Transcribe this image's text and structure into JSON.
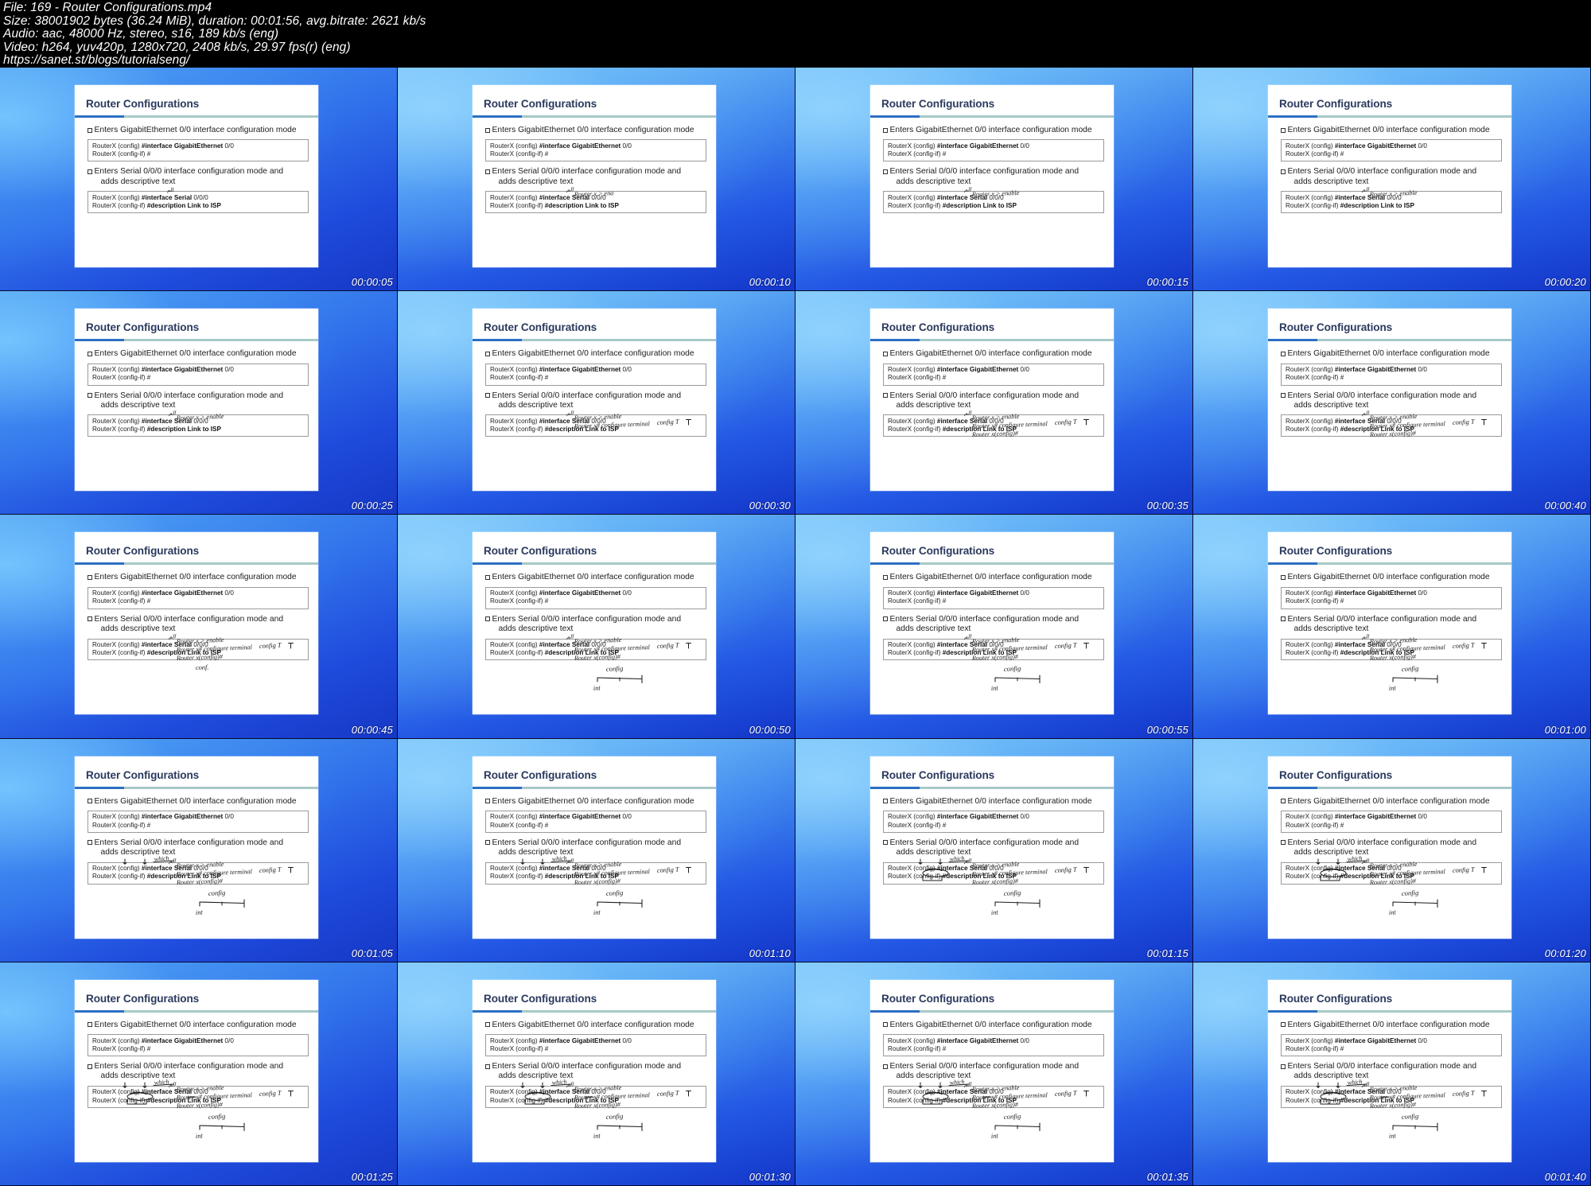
{
  "header": {
    "lines": [
      "File: 169 - Router Configurations.mp4",
      "Size: 38001902 bytes (36.24 MiB), duration: 00:01:56, avg.bitrate: 2621 kb/s",
      "Audio: aac, 48000 Hz, stereo, s16, 189 kb/s (eng)",
      "Video: h264, yuv420p, 1280x720, 2408 kb/s, 29.97 fps(r) (eng)",
      "https://sanet.st/blogs/tutorialseng/"
    ],
    "file_label": "File: 169 - Router Configurations.mp4",
    "size_label": "Size: 38001902 bytes (36.24 MiB), duration: 00:01:56, avg.bitrate: 2621 kb/s",
    "audio_label": "Audio: aac, 48000 Hz, stereo, s16, 189 kb/s (eng)",
    "video_label": "Video: h264, yuv420p, 1280x720, 2408 kb/s, 29.97 fps(r) (eng)",
    "url_label": "https://sanet.st/blogs/tutorialseng/"
  },
  "slide": {
    "title": "Router Configurations",
    "bullet1": "Enters GigabitEthernet 0/0 interface configuration mode",
    "bullet2_line1": "Enters Serial 0/0/0 interface configuration mode and",
    "bullet2_line2": "adds descriptive text",
    "code1_line1_pre": "RouterX (config) ",
    "code1_line1_bold": "#interface GigabitEthernet",
    "code1_line1_post": " 0/0",
    "code1_line2": "RouterX (config-if) #",
    "code2_line1_pre": "RouterX (config) ",
    "code2_line1_bold": "#interface Serial",
    "code2_line1_post": " 0/0/0",
    "code2_line2_pre": "RouterX (config-if) ",
    "code2_line2_bold": "#description Link to ISP"
  },
  "annotations": {
    "ink_color": "#1a1a1a",
    "line_enable": "Router x > enable",
    "line_configure": "Router x# configure terminal",
    "line_config_prompt": "Router x(config)#",
    "word_config_t": "config T",
    "word_config": "config",
    "word_conf": "conf.",
    "word_which": "which",
    "word_int": "int"
  },
  "grid": {
    "columns": 4,
    "rows": 5,
    "tiles": [
      {
        "index": 1,
        "timestamp": "00:00:05",
        "stage": 0
      },
      {
        "index": 2,
        "timestamp": "00:00:10",
        "stage": 1
      },
      {
        "index": 3,
        "timestamp": "00:00:15",
        "stage": 2
      },
      {
        "index": 4,
        "timestamp": "00:00:20",
        "stage": 3
      },
      {
        "index": 5,
        "timestamp": "00:00:25",
        "stage": 4
      },
      {
        "index": 6,
        "timestamp": "00:00:30",
        "stage": 5
      },
      {
        "index": 7,
        "timestamp": "00:00:35",
        "stage": 6
      },
      {
        "index": 8,
        "timestamp": "00:00:40",
        "stage": 7
      },
      {
        "index": 9,
        "timestamp": "00:00:45",
        "stage": 8
      },
      {
        "index": 10,
        "timestamp": "00:00:50",
        "stage": 9
      },
      {
        "index": 11,
        "timestamp": "00:00:55",
        "stage": 10
      },
      {
        "index": 12,
        "timestamp": "00:01:00",
        "stage": 10
      },
      {
        "index": 13,
        "timestamp": "00:01:05",
        "stage": 11
      },
      {
        "index": 14,
        "timestamp": "00:01:10",
        "stage": 11
      },
      {
        "index": 15,
        "timestamp": "00:01:15",
        "stage": 12
      },
      {
        "index": 16,
        "timestamp": "00:01:20",
        "stage": 12
      },
      {
        "index": 17,
        "timestamp": "00:01:25",
        "stage": 13
      },
      {
        "index": 18,
        "timestamp": "00:01:30",
        "stage": 13
      },
      {
        "index": 19,
        "timestamp": "00:01:35",
        "stage": 13
      },
      {
        "index": 20,
        "timestamp": "00:01:40",
        "stage": 13
      }
    ]
  }
}
